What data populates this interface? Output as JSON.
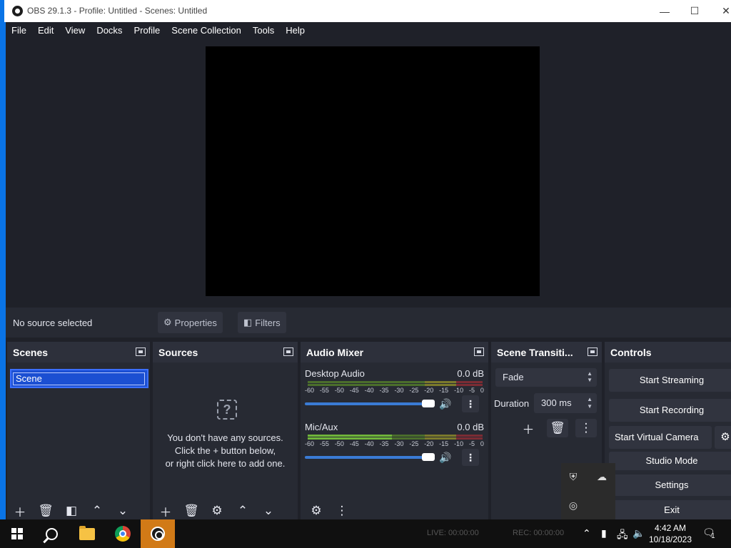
{
  "window": {
    "title": "OBS 29.1.3 - Profile: Untitled - Scenes: Untitled",
    "minimize_glyph": "—",
    "maximize_glyph": "☐",
    "close_glyph": "✕"
  },
  "menu": [
    "File",
    "Edit",
    "View",
    "Docks",
    "Profile",
    "Scene Collection",
    "Tools",
    "Help"
  ],
  "source_bar": {
    "no_source": "No source selected",
    "properties_label": "Properties",
    "filters_label": "Filters"
  },
  "scenes": {
    "title": "Scenes",
    "items": [
      "Scene"
    ]
  },
  "sources": {
    "title": "Sources",
    "empty_line1": "You don't have any sources.",
    "empty_line2": "Click the + button below,",
    "empty_line3": "or right click here to add one."
  },
  "audio_mixer": {
    "title": "Audio Mixer",
    "channels": [
      {
        "name": "Desktop Audio",
        "db": "0.0 dB"
      },
      {
        "name": "Mic/Aux",
        "db": "0.0 dB"
      }
    ],
    "scale": [
      "-60",
      "-55",
      "-50",
      "-45",
      "-40",
      "-35",
      "-30",
      "-25",
      "-20",
      "-15",
      "-10",
      "-5",
      "0"
    ]
  },
  "transitions": {
    "title": "Scene Transiti...",
    "selected": "Fade",
    "duration_label": "Duration",
    "duration_value": "300 ms"
  },
  "controls": {
    "title": "Controls",
    "start_streaming": "Start Streaming",
    "start_recording": "Start Recording",
    "start_virtual_camera": "Start Virtual Camera",
    "studio_mode": "Studio Mode",
    "settings": "Settings",
    "exit": "Exit"
  },
  "status": {
    "live": "LIVE: 00:00:00",
    "rec": "REC: 00:00:00"
  },
  "taskbar": {
    "time": "4:42 AM",
    "date": "10/18/2023",
    "notification_count": "1"
  },
  "colors": {
    "accent": "#0a74e6",
    "scene_selected": "#1b4fd2",
    "panel": "#272a33",
    "panel_header": "#2d303b",
    "button": "#31343f"
  }
}
